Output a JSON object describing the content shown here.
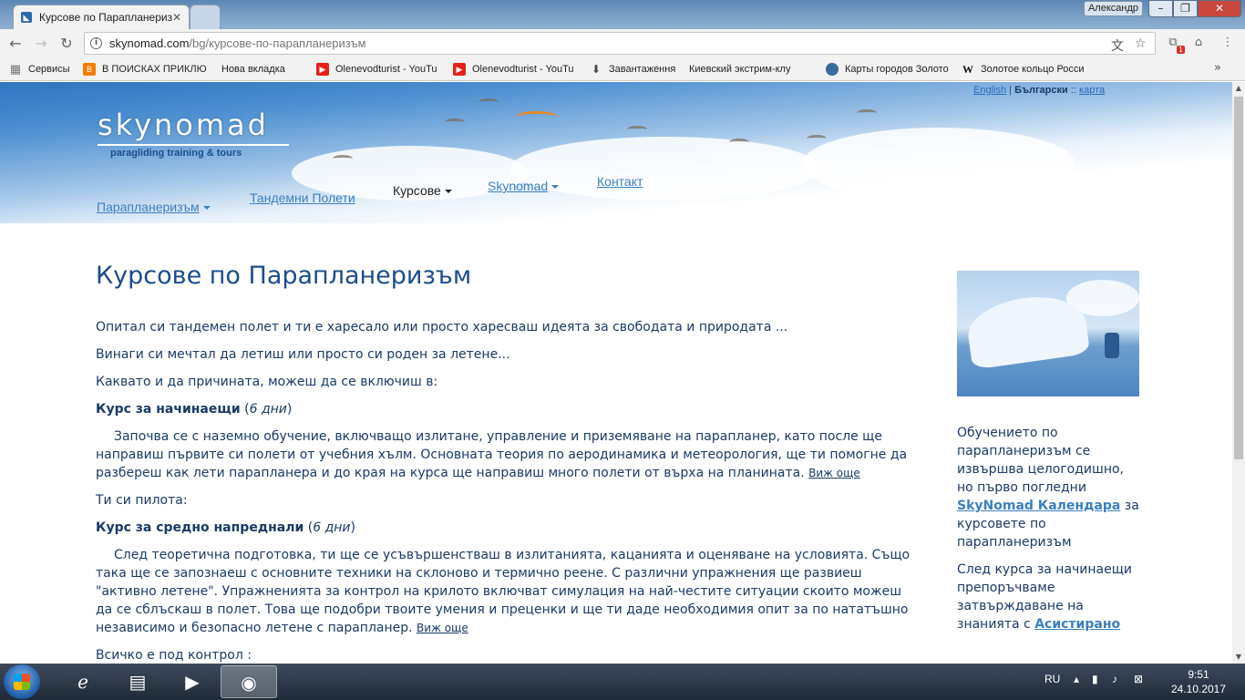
{
  "browser": {
    "tab_title": "Курсове по Парапланериз",
    "user_name": "Александр",
    "url_host": "skynomad.com",
    "url_path": "/bg/курсове-по-парапланеризъм"
  },
  "bookmarks": [
    {
      "label": "Сервисы",
      "icon": "apps-icon"
    },
    {
      "label": "В ПОИСКАХ ПРИКЛЮ",
      "icon": "blogger-icon"
    },
    {
      "label": "Нова вкладка",
      "icon": "page-icon"
    },
    {
      "label": "Olenevodturist - YouTu",
      "icon": "youtube-icon"
    },
    {
      "label": "Olenevodturist - YouTu",
      "icon": "youtube-icon"
    },
    {
      "label": "Завантаження",
      "icon": "download-icon"
    },
    {
      "label": "Киевский экстрим-клу",
      "icon": "page-icon"
    },
    {
      "label": "Карты городов Золото",
      "icon": "globe-icon"
    },
    {
      "label": "Золотое кольцо Росси",
      "icon": "wikipedia-icon"
    }
  ],
  "site": {
    "logo_word": "skynomad",
    "logo_tagline": "paragliding training & tours",
    "lang_en": "English",
    "lang_sep": "|",
    "lang_bg": "Български",
    "lang_sep2": "::",
    "lang_map": "карта",
    "nav": [
      {
        "label": "Парапланеризъм"
      },
      {
        "label": "Тандемни Полети"
      },
      {
        "label": "Курсове"
      },
      {
        "label": "Skynomad"
      },
      {
        "label": "Контакт"
      }
    ]
  },
  "main": {
    "title": "Курсове по Парапланеризъм",
    "p1": "Опитал си тандемен полет и ти е харесало или просто харесваш идеята за свободата и природата ...",
    "p2": "Винаги си мечтал да летиш или просто си роден за летене...",
    "p3": "Каквато и да причината, можеш да се включиш в:",
    "course1_title": "Курс за начинаещи",
    "course1_days_open": " (",
    "course1_days": "6 дни",
    "course1_days_close": ")",
    "course1_text": "Започва се с наземно обучение, включващо излитане, управление и приземяване на парапланер, като после ще направиш първите си полети от учебния хълм. Основната теория по аеродинамика и метеорология, ще ти помогне да разбереш как лети парапланера и до края на курса ще направиш много полети от върха на планината.",
    "course1_more": "Виж още",
    "p4": "Ти си пилота:",
    "course2_title": "Курс за средно напреднали",
    "course2_days": "6 дни",
    "course2_text": "След теоретична подготовка, ти ще се усъвършенстваш в излитанията, кацанията и оценяване на условията. Също така ще се запознаеш с основните техники на склоново и термично реене. С различни упражнения ще развиеш \"активно летене\". Упражненията за контрол на крилото включват симулация на най-честите ситуации скоито можеш да се сблъскаш в полет. Това ще подобри твоите умения и преценки и ще ти даде необходимия опит за по нататъшно независимо и безопасно летене с парапланер.",
    "course2_more": "Виж още",
    "p5": "Всичко е под контрол :"
  },
  "sidebar": {
    "t1_a": "Обучението по парапланеризъм се извършва целогодишно, но първо погледни ",
    "t1_link": "SkyNomad Календара",
    "t1_b": " за курсовете по парапланеризъм",
    "t2_a": "След курса за начинаещи препоръчваме затвърждаване на знанията с ",
    "t2_link": "Асистирано"
  },
  "taskbar": {
    "lang": "RU",
    "time": "9:51",
    "date": "24.10.2017"
  },
  "colors": {
    "heading": "#1a4d8c",
    "link": "#3a7fc0",
    "text": "#1a3a66"
  }
}
